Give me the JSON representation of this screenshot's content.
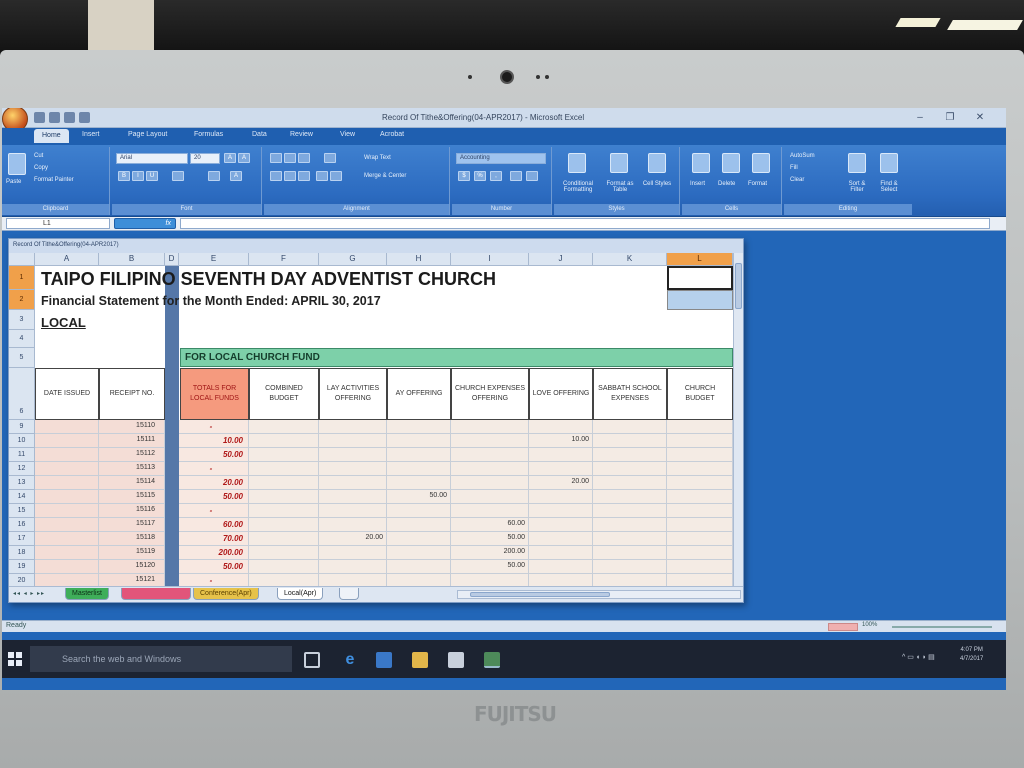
{
  "window": {
    "title": "Record Of Tithe&Offering(04-APR2017) - Microsoft Excel",
    "workbook_title": "Record Of Tithe&Offering(04-APR2017)"
  },
  "ribbon": {
    "tabs": [
      "Home",
      "Insert",
      "Page Layout",
      "Formulas",
      "Data",
      "Review",
      "View",
      "Acrobat"
    ],
    "active_tab": "Home",
    "clipboard": {
      "paste": "Paste",
      "cut": "Cut",
      "copy": "Copy",
      "format_painter": "Format Painter",
      "label": "Clipboard"
    },
    "font": {
      "name": "Arial",
      "size": "20",
      "label": "Font"
    },
    "alignment": {
      "wrap": "Wrap Text",
      "merge": "Merge & Center",
      "label": "Alignment"
    },
    "number": {
      "format": "Accounting",
      "label": "Number"
    },
    "styles": {
      "conditional": "Conditional Formatting",
      "format_table": "Format as Table",
      "cell_styles": "Cell Styles",
      "label": "Styles"
    },
    "cells": {
      "insert": "Insert",
      "delete": "Delete",
      "format": "Format",
      "label": "Cells"
    },
    "editing": {
      "autosum": "AutoSum",
      "fill": "Fill",
      "clear": "Clear",
      "sort": "Sort & Filter",
      "find": "Find & Select",
      "label": "Editing"
    }
  },
  "formula_bar": {
    "name_box": "L1",
    "fx": "fx",
    "value": ""
  },
  "sheet": {
    "columns": [
      "A",
      "B",
      "D",
      "E",
      "F",
      "G",
      "H",
      "I",
      "J",
      "K",
      "L"
    ],
    "selected_column": "L",
    "rows": [
      "1",
      "2",
      "3",
      "4",
      "5",
      "6",
      "9",
      "10",
      "11",
      "12",
      "13",
      "14",
      "15",
      "16",
      "17",
      "18",
      "19",
      "20"
    ],
    "title": "TAIPO FILIPINO SEVENTH DAY ADVENTIST CHURCH",
    "subtitle": "Financial Statement for the Month Ended: APRIL 30, 2017",
    "section": "LOCAL",
    "band": "FOR LOCAL CHURCH FUND",
    "headers": [
      "DATE ISSUED",
      "RECEIPT NO.",
      "TOTALS FOR LOCAL FUNDS",
      "COMBINED BUDGET",
      "LAY ACTIVITIES OFFERING",
      "AY OFFERING",
      "CHURCH EXPENSES OFFERING",
      "LOVE OFFERING",
      "SABBATH SCHOOL EXPENSES",
      "CHURCH BUDGET"
    ],
    "data_rows": [
      {
        "receipt": "15110",
        "total": "-",
        "lay": "",
        "ay": "",
        "church": "",
        "love": ""
      },
      {
        "receipt": "15111",
        "total": "10.00",
        "lay": "",
        "ay": "",
        "church": "",
        "love": "10.00"
      },
      {
        "receipt": "15112",
        "total": "50.00",
        "lay": "",
        "ay": "",
        "church": "",
        "love": ""
      },
      {
        "receipt": "15113",
        "total": "-",
        "lay": "",
        "ay": "",
        "church": "",
        "love": ""
      },
      {
        "receipt": "15114",
        "total": "20.00",
        "lay": "",
        "ay": "",
        "church": "",
        "love": "20.00"
      },
      {
        "receipt": "15115",
        "total": "50.00",
        "lay": "",
        "ay": "50.00",
        "church": "",
        "love": ""
      },
      {
        "receipt": "15116",
        "total": "-",
        "lay": "",
        "ay": "",
        "church": "",
        "love": ""
      },
      {
        "receipt": "15117",
        "total": "60.00",
        "lay": "",
        "ay": "",
        "church": "60.00",
        "love": ""
      },
      {
        "receipt": "15118",
        "total": "70.00",
        "lay": "20.00",
        "ay": "",
        "church": "50.00",
        "love": ""
      },
      {
        "receipt": "15119",
        "total": "200.00",
        "lay": "",
        "ay": "",
        "church": "200.00",
        "love": ""
      },
      {
        "receipt": "15120",
        "total": "50.00",
        "lay": "",
        "ay": "",
        "church": "50.00",
        "love": ""
      },
      {
        "receipt": "15121",
        "total": "-",
        "lay": "",
        "ay": "",
        "church": "",
        "love": ""
      }
    ],
    "tabs": [
      "Masterlist",
      "",
      "Conference(Apr)",
      "Local(Apr)"
    ],
    "active_tab": "Local(Apr)"
  },
  "status": {
    "text": "Ready",
    "zoom": "100%"
  },
  "taskbar": {
    "search_placeholder": "Search the web and Windows",
    "time": "4:07 PM",
    "date": "4/7/2017"
  },
  "hardware": {
    "brand": "FUJITSU"
  },
  "colors": {
    "totals_header": "#f59a7e",
    "band": "#7dd0a9",
    "selected_header": "#f0a04a",
    "ribbon": "#2c6bc0"
  }
}
